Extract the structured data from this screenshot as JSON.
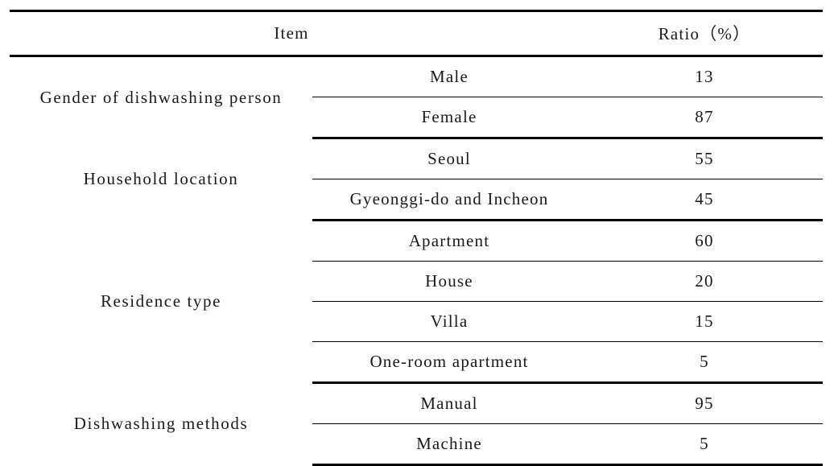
{
  "table": {
    "columns": {
      "item": "Item",
      "ratio": "Ratio（%）"
    },
    "sections": [
      {
        "group_label": "Gender of dishwashing person",
        "rows": [
          {
            "label": "Male",
            "ratio": "13"
          },
          {
            "label": "Female",
            "ratio": "87"
          }
        ]
      },
      {
        "group_label": "Household location",
        "rows": [
          {
            "label": "Seoul",
            "ratio": "55"
          },
          {
            "label": "Gyeonggi-do and Incheon",
            "ratio": "45"
          }
        ]
      },
      {
        "group_label": "Residence type",
        "rows": [
          {
            "label": "Apartment",
            "ratio": "60"
          },
          {
            "label": "House",
            "ratio": "20"
          },
          {
            "label": "Villa",
            "ratio": "15"
          },
          {
            "label": "One-room apartment",
            "ratio": "5"
          }
        ]
      },
      {
        "group_label": "Dishwashing methods",
        "rows": [
          {
            "label": "Manual",
            "ratio": "95"
          },
          {
            "label": "Machine",
            "ratio": "5"
          }
        ]
      }
    ]
  },
  "chart_data": {
    "type": "table",
    "title": "",
    "columns": [
      "Item",
      "Ratio（%）"
    ],
    "categories": [
      "Gender of dishwashing person",
      "Household location",
      "Residence type",
      "Dishwashing methods"
    ],
    "series": [
      {
        "name": "Gender of dishwashing person",
        "labels": [
          "Male",
          "Female"
        ],
        "values": [
          13,
          87
        ]
      },
      {
        "name": "Household location",
        "labels": [
          "Seoul",
          "Gyeonggi-do and Incheon"
        ],
        "values": [
          55,
          45
        ]
      },
      {
        "name": "Residence type",
        "labels": [
          "Apartment",
          "House",
          "Villa",
          "One-room apartment"
        ],
        "values": [
          60,
          20,
          15,
          5
        ]
      },
      {
        "name": "Dishwashing methods",
        "labels": [
          "Manual",
          "Machine"
        ],
        "values": [
          95,
          5
        ]
      }
    ],
    "ylabel": "Ratio (%)",
    "xlabel": "Item",
    "ylim": [
      0,
      100
    ],
    "grid": false,
    "legend": "none"
  }
}
